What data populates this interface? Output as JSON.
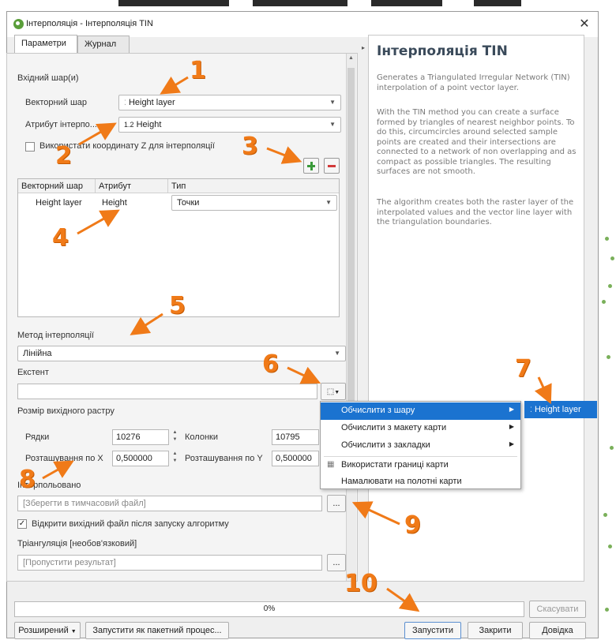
{
  "window": {
    "title": "Інтерполяція - Інтерполяція TIN",
    "close_glyph": "✕"
  },
  "tabs": [
    {
      "label": "Параметри",
      "active": true
    },
    {
      "label": "Журнал",
      "active": false
    }
  ],
  "params": {
    "input_layers_label": "Вхідний шар(и)",
    "vector_layer_label": "Векторний шар",
    "vector_layer_value": "Height layer",
    "attribute_label": "Атрибут інтерпо...",
    "attribute_value": "Height",
    "attribute_type_badge": "1.2",
    "use_z_label": "Використати координату Z для інтерполяції",
    "use_z_checked": false,
    "table": {
      "headers": [
        "Векторний шар",
        "Атрибут",
        "Тип"
      ],
      "rows": [
        {
          "layer": "Height layer",
          "attribute": "Height",
          "type": "Точки"
        }
      ]
    },
    "method_label": "Метод інтерполяції",
    "method_value": "Лінійна",
    "extent_label": "Екстент",
    "extent_value": "",
    "raster_size_label": "Розмір вихідного растру",
    "rows_label": "Рядки",
    "rows_value": "10276",
    "columns_label": "Колонки",
    "columns_value": "10795",
    "pixel_x_label": "Розташування по X",
    "pixel_x_value": "0,500000",
    "pixel_y_label": "Розташування по Y",
    "pixel_y_value": "0,500000",
    "interpolated_label": "Інтерпольовано",
    "interpolated_placeholder": "[Зберегти в тимчасовий файл]",
    "open_output_label": "Відкрити вихідний файл після запуску алгоритму",
    "open_output_checked": true,
    "triangulation_label": "Тріангуляція [необов'язковий]",
    "triangulation_placeholder": "[Пропустити результат]",
    "browse_label": "..."
  },
  "extent_menu": {
    "items": [
      {
        "label": "Обчислити з шару",
        "submenu": true,
        "highlighted": true
      },
      {
        "label": "Обчислити з макету карти",
        "submenu": true,
        "highlighted": false
      },
      {
        "label": "Обчислити з закладки",
        "submenu": true,
        "highlighted": false
      },
      {
        "label": "Використати границі карти",
        "submenu": false,
        "highlighted": false
      },
      {
        "label": "Намалювати на полотні карти",
        "submenu": false,
        "highlighted": false
      }
    ],
    "submenu_item": "Height layer"
  },
  "help": {
    "title": "Інтерполяція TIN",
    "paragraphs": [
      "Generates a Triangulated Irregular Network (TIN) interpolation of a point vector layer.",
      "With the TIN method you can create a surface formed by triangles of nearest neighbor points. To do this, circumcircles around selected sample points are created and their intersections are connected to a network of non overlapping and as compact as possible triangles. The resulting surfaces are not smooth.",
      "The algorithm creates both the raster layer of the interpolated values and the vector line layer with the triangulation boundaries."
    ]
  },
  "footer": {
    "progress_text": "0%",
    "progress_value": 0,
    "cancel_label": "Скасувати",
    "advanced_label": "Розширений",
    "batch_label": "Запустити як пакетний процес...",
    "run_label": "Запустити",
    "close_label": "Закрити",
    "help_label": "Довідка"
  },
  "annotations": [
    "1",
    "2",
    "3",
    "4",
    "5",
    "6",
    "7",
    "8",
    "9",
    "10"
  ],
  "colors": {
    "accent": "#1b73d0",
    "annotation": "#f07a18",
    "add_button": "#3a9a3a",
    "remove_button": "#d23a3a"
  }
}
